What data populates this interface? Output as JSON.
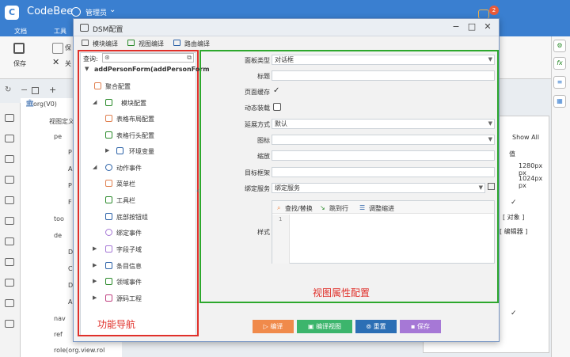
{
  "app": {
    "title": "CodeBee",
    "logo": "bee-logo-icon",
    "user": "管理员",
    "notification_count": "2"
  },
  "menu": [
    "文档",
    "工具"
  ],
  "toolbar": {
    "save": "保存",
    "close": "关",
    "save2": "保"
  },
  "bg_tree": {
    "root": "org(V0)",
    "view_def": "视图定义",
    "items": [
      "pe",
      "P",
      "A",
      "P",
      "F",
      "too",
      "de",
      "D",
      "C",
      "D",
      "A",
      "nav",
      "ref",
      "role(org.view.rol"
    ]
  },
  "right_panel": {
    "show_all": "Show All",
    "col_value": "值",
    "rows": [
      "1280px px",
      "1024px px"
    ],
    "obj": "[ 对象 ]",
    "editor": "[ 编辑器 ]"
  },
  "dialog": {
    "title": "DSM配置",
    "tabs": [
      "模块编译",
      "视图编译",
      "路由编译"
    ],
    "search_label": "查询:",
    "nav_items": [
      {
        "label": "addPersonForm(addPersonForm",
        "level": 0,
        "caret": "▼"
      },
      {
        "label": "聚合配置",
        "level": 0,
        "caret": ""
      },
      {
        "label": "模块配置",
        "level": 1,
        "caret": "◢"
      },
      {
        "label": "表格布局配置",
        "level": 2,
        "caret": ""
      },
      {
        "label": "表格行头配置",
        "level": 2,
        "caret": ""
      },
      {
        "label": "环境变量",
        "level": 2,
        "caret": "▶"
      },
      {
        "label": "动作事件",
        "level": 1,
        "caret": "◢"
      },
      {
        "label": "菜单栏",
        "level": 1,
        "caret": ""
      },
      {
        "label": "工具栏",
        "level": 1,
        "caret": ""
      },
      {
        "label": "底部按钮组",
        "level": 1,
        "caret": ""
      },
      {
        "label": "绑定事件",
        "level": 1,
        "caret": ""
      },
      {
        "label": "字段子域",
        "level": 0,
        "caret": "▶"
      },
      {
        "label": "条目信息",
        "level": 0,
        "caret": "▶"
      },
      {
        "label": "领域事件",
        "level": 0,
        "caret": "▶"
      },
      {
        "label": "源码工程",
        "level": 0,
        "caret": "▶"
      }
    ],
    "nav_annotation": "功能导航",
    "props": [
      {
        "label": "面板类型",
        "value": "对话框",
        "kind": "select"
      },
      {
        "label": "标题",
        "value": "",
        "kind": "text"
      },
      {
        "label": "页面缓存",
        "value": "✓",
        "kind": "check"
      },
      {
        "label": "动态装载",
        "value": "",
        "kind": "checkbox"
      },
      {
        "label": "延展方式",
        "value": "默认",
        "kind": "select"
      },
      {
        "label": "图标",
        "value": "",
        "kind": "select"
      },
      {
        "label": "缩放",
        "value": "",
        "kind": "text"
      },
      {
        "label": "目标框架",
        "value": "",
        "kind": "text"
      },
      {
        "label": "绑定服务",
        "value": "绑定服务",
        "kind": "select"
      }
    ],
    "style_label": "样式",
    "style_tools": [
      "查找/替换",
      "跳到行",
      "调整缩进"
    ],
    "line_number": "1",
    "prop_annotation": "视图属性配置",
    "buttons": [
      {
        "label": "编译",
        "color": "#f08a4b"
      },
      {
        "label": "编译视图",
        "color": "#3cb56c"
      },
      {
        "label": "重置",
        "color": "#2c6fb5"
      },
      {
        "label": "保存",
        "color": "#a678d6"
      }
    ]
  }
}
